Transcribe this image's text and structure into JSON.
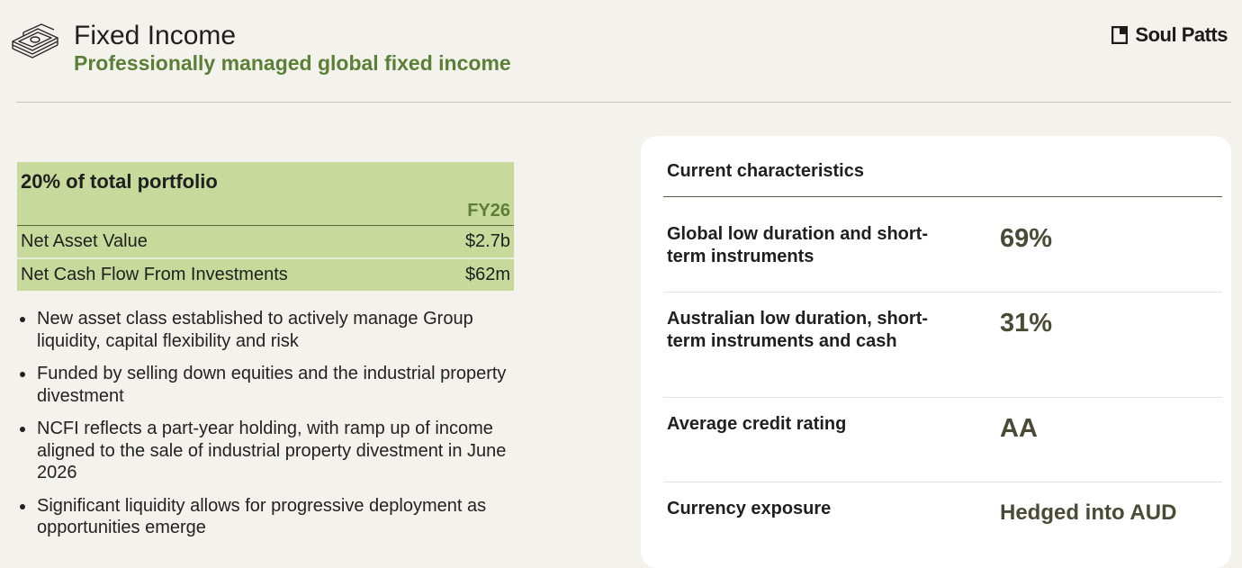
{
  "header": {
    "title": "Fixed Income",
    "subtitle": "Professionally managed global fixed income",
    "icon": "money-stack-icon",
    "logo_text": "Soul Patts"
  },
  "summary": {
    "heading": "20% of total portfolio",
    "column_header": "FY26",
    "rows": [
      {
        "label": "Net Asset Value",
        "value": "$2.7b"
      },
      {
        "label": "Net Cash Flow From Investments",
        "value": "$62m"
      }
    ]
  },
  "bullets": [
    "New asset class established to actively manage Group liquidity, capital flexibility and risk",
    "Funded by selling down equities and the industrial property divestment",
    "NCFI reflects a part-year holding, with ramp up of income aligned to the sale of industrial property divestment in June 2026",
    "Significant liquidity allows for progressive deployment as opportunities emerge"
  ],
  "characteristics": {
    "title": "Current characteristics",
    "rows": [
      {
        "label": "Global low duration and short-term instruments",
        "value": "69%"
      },
      {
        "label": "Australian low duration, short-term instruments and cash",
        "value": "31%"
      },
      {
        "label": "Average credit rating",
        "value": "AA"
      },
      {
        "label": "Currency exposure",
        "value": "Hedged into AUD"
      }
    ]
  },
  "colors": {
    "accent_green": "#5b7f35",
    "table_fill": "#c8d99c",
    "background": "#f3f2ec",
    "value_text": "#4a4a36"
  }
}
